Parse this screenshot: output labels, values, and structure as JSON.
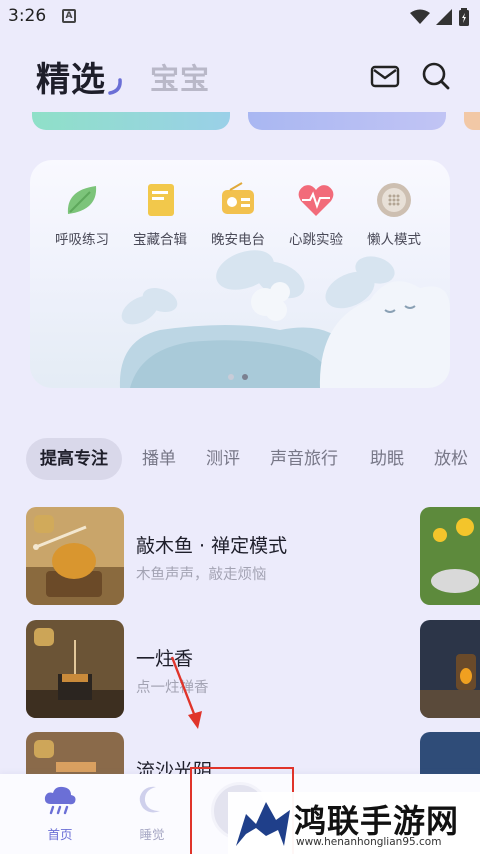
{
  "status_bar": {
    "time": "3:26",
    "notif_badge": "A"
  },
  "header": {
    "tab_selected": "精选",
    "tab_other": "宝宝",
    "icons": [
      "mail-icon",
      "search-icon"
    ]
  },
  "features": [
    {
      "label": "呼吸练习",
      "icon": "leaf-icon",
      "color": "#7cc47a"
    },
    {
      "label": "宝藏合辑",
      "icon": "book-icon",
      "color": "#f2c84b"
    },
    {
      "label": "晚安电台",
      "icon": "radio-icon",
      "color": "#f2c14e"
    },
    {
      "label": "心跳实验",
      "icon": "heart-icon",
      "color": "#f26b7a"
    },
    {
      "label": "懒人模式",
      "icon": "speaker-icon",
      "color": "#c9b8a6"
    }
  ],
  "carousel": {
    "pages": 2,
    "active_page": 2
  },
  "categories": [
    "提高专注",
    "播单",
    "测评",
    "声音旅行",
    "助眠",
    "放松"
  ],
  "active_category": "提高专注",
  "list": [
    {
      "title": "敲木鱼 · 禅定模式",
      "subtitle": "木鱼声声，敲走烦恼"
    },
    {
      "title": "一炷香",
      "subtitle": "点一炷禅香"
    },
    {
      "title": "流沙光阴",
      "subtitle": ""
    }
  ],
  "bottom_nav": [
    {
      "label": "首页",
      "icon": "cloud-rain-icon",
      "active": true
    },
    {
      "label": "睡觉",
      "icon": "moon-icon",
      "active": false
    }
  ],
  "colors": {
    "accent": "#6b6fd6",
    "background": "#ecebfb"
  },
  "watermark": {
    "title": "鸿联手游网",
    "url": "www.henanhonglian95.com"
  }
}
